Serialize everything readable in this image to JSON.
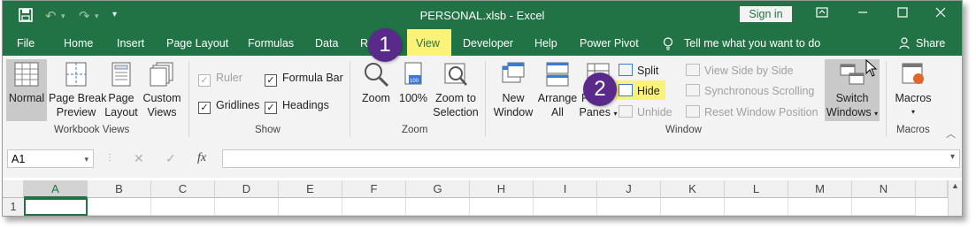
{
  "titlebar": {
    "save_icon": "save-icon",
    "undo_icon": "undo-icon",
    "redo_icon": "redo-icon",
    "customize_icon": "customize-qat-icon",
    "title": "PERSONAL.xlsb - Excel",
    "signin": "Sign in",
    "ribbon_options_icon": "ribbon-display-icon",
    "minimize": "minimize-icon",
    "maximize": "maximize-icon",
    "close": "close-icon"
  },
  "tabs": {
    "file": "File",
    "home": "Home",
    "insert": "Insert",
    "page_layout": "Page Layout",
    "formulas": "Formulas",
    "data": "Data",
    "review": "Re",
    "view": "View",
    "developer": "Developer",
    "help": "Help",
    "power_pivot": "Power Pivot",
    "tell_me": "Tell me what you want to do",
    "share": "Share"
  },
  "workbook_views": {
    "label": "Workbook Views",
    "normal": "Normal",
    "page_break_1": "Page Break",
    "page_break_2": "Preview",
    "page_layout_1": "Page",
    "page_layout_2": "Layout",
    "custom_1": "Custom",
    "custom_2": "Views"
  },
  "show": {
    "label": "Show",
    "ruler": "Ruler",
    "formula_bar": "Formula Bar",
    "gridlines": "Gridlines",
    "headings": "Headings"
  },
  "zoom": {
    "label": "Zoom",
    "zoom": "Zoom",
    "hundred": "100%",
    "to_selection_1": "Zoom to",
    "to_selection_2": "Selection"
  },
  "window": {
    "label": "Window",
    "new_1": "New",
    "new_2": "Window",
    "arrange_1": "Arrange",
    "arrange_2": "All",
    "freeze_1": "Fr",
    "freeze_2": "Panes",
    "split": "Split",
    "hide": "Hide",
    "unhide": "Unhide",
    "side_by_side": "View Side by Side",
    "sync_scroll": "Synchronous Scrolling",
    "reset_position": "Reset Window Position",
    "switch_1": "Switch",
    "switch_2": "Windows"
  },
  "macros": {
    "label": "Macros",
    "button": "Macros"
  },
  "formula_bar": {
    "name_box": "A1",
    "cancel": "✕",
    "enter": "✓",
    "fx": "fx",
    "value": ""
  },
  "grid": {
    "columns": [
      "A",
      "B",
      "C",
      "D",
      "E",
      "F",
      "G",
      "H",
      "I",
      "J",
      "K",
      "L",
      "M",
      "N"
    ],
    "row": "1"
  },
  "callouts": {
    "one": "1",
    "two": "2"
  },
  "colors": {
    "excel_green": "#217346",
    "highlight": "#fbf27a",
    "callout": "#5a2a8a"
  }
}
